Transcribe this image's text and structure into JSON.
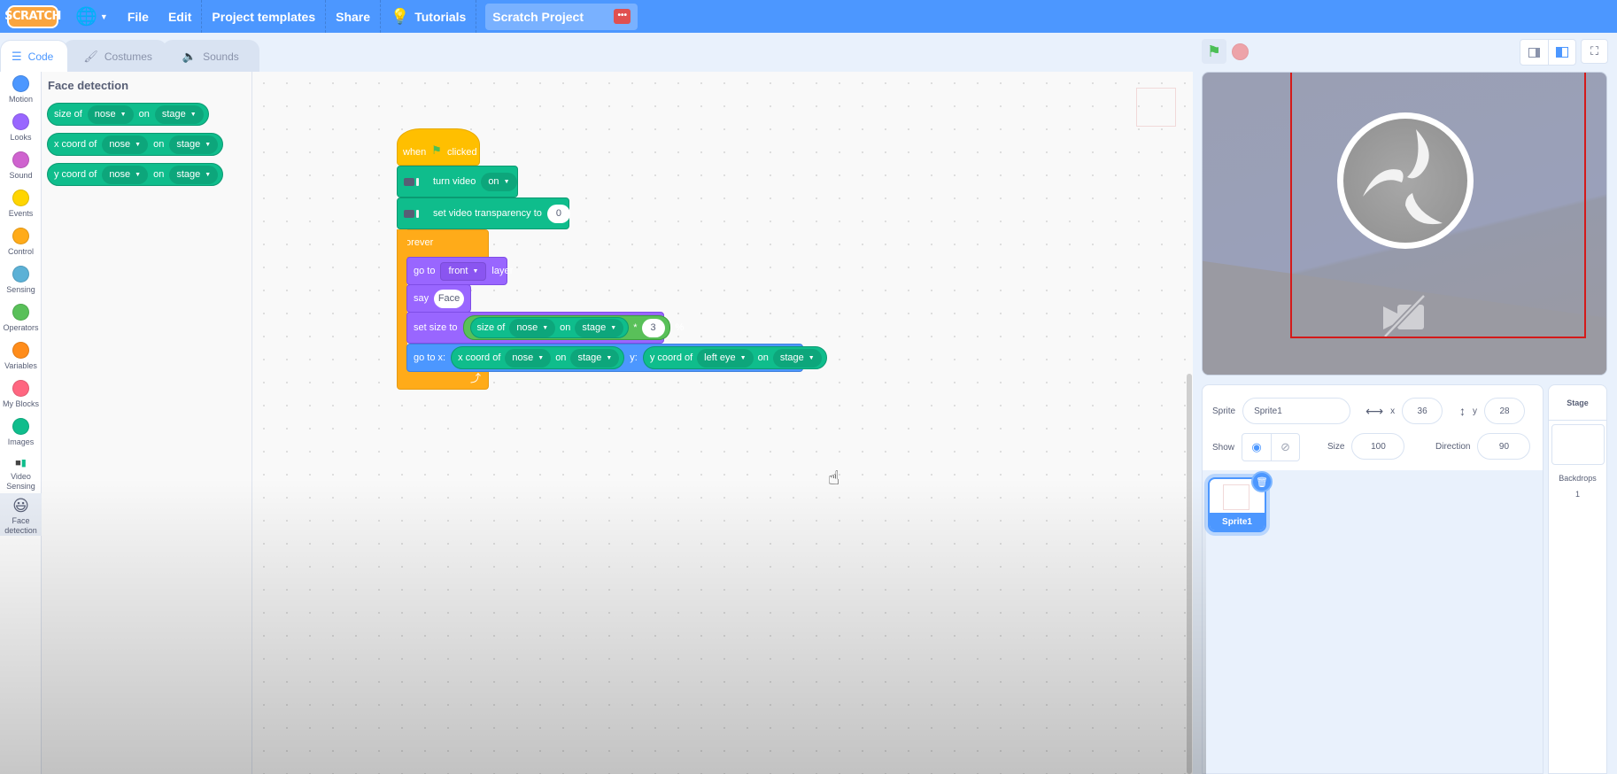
{
  "menubar": {
    "logo": "SCRATCH",
    "language_icon": "globe-icon",
    "items": [
      "File",
      "Edit",
      "Project templates",
      "Share",
      "Tutorials"
    ],
    "project_title": "Scratch Project",
    "project_menu_icon": "more-icon",
    "brand_color": "#4c97ff"
  },
  "tabs": [
    {
      "label": "Code",
      "icon": "code-icon",
      "active": true
    },
    {
      "label": "Costumes",
      "icon": "brush-icon",
      "active": false
    },
    {
      "label": "Sounds",
      "icon": "speaker-icon",
      "active": false
    }
  ],
  "categories": [
    {
      "label": "Motion",
      "color": "#4c97ff"
    },
    {
      "label": "Looks",
      "color": "#9966ff"
    },
    {
      "label": "Sound",
      "color": "#cf63cf"
    },
    {
      "label": "Events",
      "color": "#ffd500"
    },
    {
      "label": "Control",
      "color": "#ffab19"
    },
    {
      "label": "Sensing",
      "color": "#5cb1d6"
    },
    {
      "label": "Operators",
      "color": "#59c059"
    },
    {
      "label": "Variables",
      "color": "#ff8c1a"
    },
    {
      "label": "My Blocks",
      "color": "#ff6680"
    },
    {
      "label": "Images",
      "color": "#0fbd8c"
    },
    {
      "label": "Video Sensing",
      "icon": "video-sensing-icon"
    },
    {
      "label": "Face detection",
      "icon": "smiley-icon",
      "selected": true
    }
  ],
  "flyout": {
    "title": "Face detection",
    "blocks": [
      {
        "prefix": "size of",
        "part": "nose",
        "mid": "on",
        "target": "stage"
      },
      {
        "prefix": "x coord of",
        "part": "nose",
        "mid": "on",
        "target": "stage"
      },
      {
        "prefix": "y coord of",
        "part": "nose",
        "mid": "on",
        "target": "stage"
      }
    ]
  },
  "script": {
    "hat": {
      "when": "when",
      "clicked": "clicked"
    },
    "turn_video": {
      "label": "turn video",
      "value": "on"
    },
    "transparency": {
      "label": "set video transparency to",
      "value": "0"
    },
    "forever": "forever",
    "goto_layer": {
      "label": "go to",
      "value": "front",
      "suffix": "layer"
    },
    "say": {
      "label": "say",
      "value": "Face"
    },
    "set_size": {
      "label": "set size to",
      "reporter": "size of",
      "part": "nose",
      "mid": "on",
      "target": "stage",
      "op": "*",
      "factor": "3",
      "suffix": "%"
    },
    "goto_xy": {
      "label": "go to x:",
      "x_reporter": "x coord of",
      "x_part": "nose",
      "x_mid": "on",
      "x_target": "stage",
      "y_label": "y:",
      "y_reporter": "y coord of",
      "y_part": "left eye",
      "y_mid": "on",
      "y_target": "stage"
    },
    "loop_arrow": "⤴"
  },
  "sprite_info": {
    "sprite_label": "Sprite",
    "sprite_name": "Sprite1",
    "x_label": "x",
    "x": "36",
    "y_label": "y",
    "y": "28",
    "show_label": "Show",
    "size_label": "Size",
    "size": "100",
    "direction_label": "Direction",
    "direction": "90"
  },
  "sprites": [
    {
      "name": "Sprite1",
      "selected": true
    }
  ],
  "stage_selector": {
    "title": "Stage",
    "backdrops_label": "Backdrops",
    "backdrops_count": "1"
  }
}
